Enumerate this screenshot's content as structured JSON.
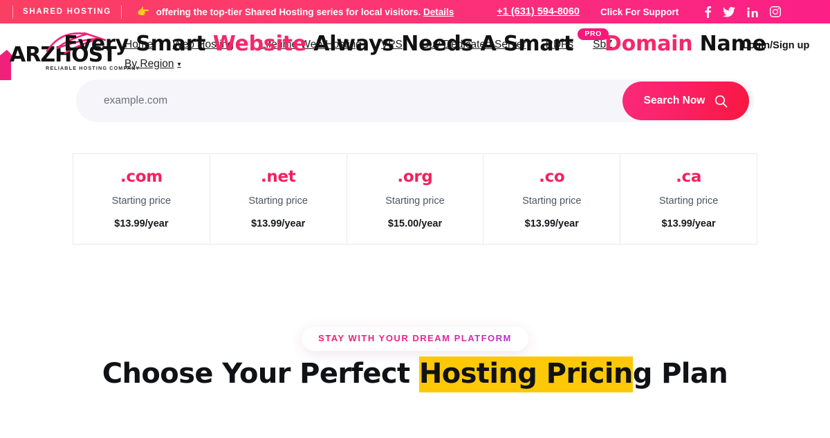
{
  "topbar": {
    "tag": "SHARED HOSTING",
    "hand_icon": "pointing-hand-icon",
    "message_before": "offering the top-tier Shared Hosting series for local visitors.",
    "message_link": "Details",
    "phone": "+1 (631) 594-8060",
    "support": "Click For Support",
    "socials": [
      {
        "name": "facebook-icon",
        "label": "Facebook"
      },
      {
        "name": "twitter-icon",
        "label": "Twitter"
      },
      {
        "name": "linkedin-icon",
        "label": "LinkedIn"
      },
      {
        "name": "instagram-icon",
        "label": "Instagram"
      }
    ],
    "bg_gradient_from": "#fb3e63",
    "bg_gradient_to": "#fb1f86"
  },
  "logo": {
    "name": "ARZHOST",
    "part_a": "ARZ",
    "part_b": "HOST",
    "tagline": "RELIABLE HOSTING COMPANY",
    "accent": "#f0217a"
  },
  "nav": {
    "items": [
      {
        "label": "Home",
        "caret": false
      },
      {
        "label": "Web Hosting",
        "caret": true
      },
      {
        "label": "Lifetime Web Hosting",
        "caret": false
      },
      {
        "label": "VPS",
        "caret": false
      },
      {
        "label": "Buy Dedicated Server",
        "caret": false
      },
      {
        "label": "RDPs",
        "caret": false
      },
      {
        "label": "SbZ",
        "caret": false
      },
      {
        "label": "By Region",
        "caret": true
      }
    ],
    "login": "Login/Sign up"
  },
  "hero": {
    "title_part1": "Every Smart ",
    "title_highlight1": "Website",
    "title_part2": " Always Needs A Smart ",
    "title_highlight2": "Domain",
    "title_part3": " Name",
    "pro_badge": "PRO",
    "accent": "#f5276a"
  },
  "search": {
    "placeholder": "example.com",
    "value": "",
    "button_label": "Search Now",
    "button_icon": "search-icon",
    "button_gradient_from": "#fb2a7a",
    "button_gradient_to": "#f7183f"
  },
  "tlds": {
    "subtitle_label": "Starting price",
    "items": [
      {
        "name": ".com",
        "sub": "Starting price",
        "price": "$13.99/year"
      },
      {
        "name": ".net",
        "sub": "Starting price",
        "price": "$13.99/year"
      },
      {
        "name": ".org",
        "sub": "Starting price",
        "price": "$15.00/year"
      },
      {
        "name": ".co",
        "sub": "Starting price",
        "price": "$13.99/year"
      },
      {
        "name": ".ca",
        "sub": "Starting price",
        "price": "$13.99/year"
      }
    ]
  },
  "pricing_section": {
    "eyebrow": "STAY WITH YOUR DREAM PLATFORM",
    "title_part1": "Choose Your Perfect ",
    "title_highlight": "Hosting Pricin",
    "title_part2": "g Plan",
    "highlight_color": "#fdc907"
  }
}
